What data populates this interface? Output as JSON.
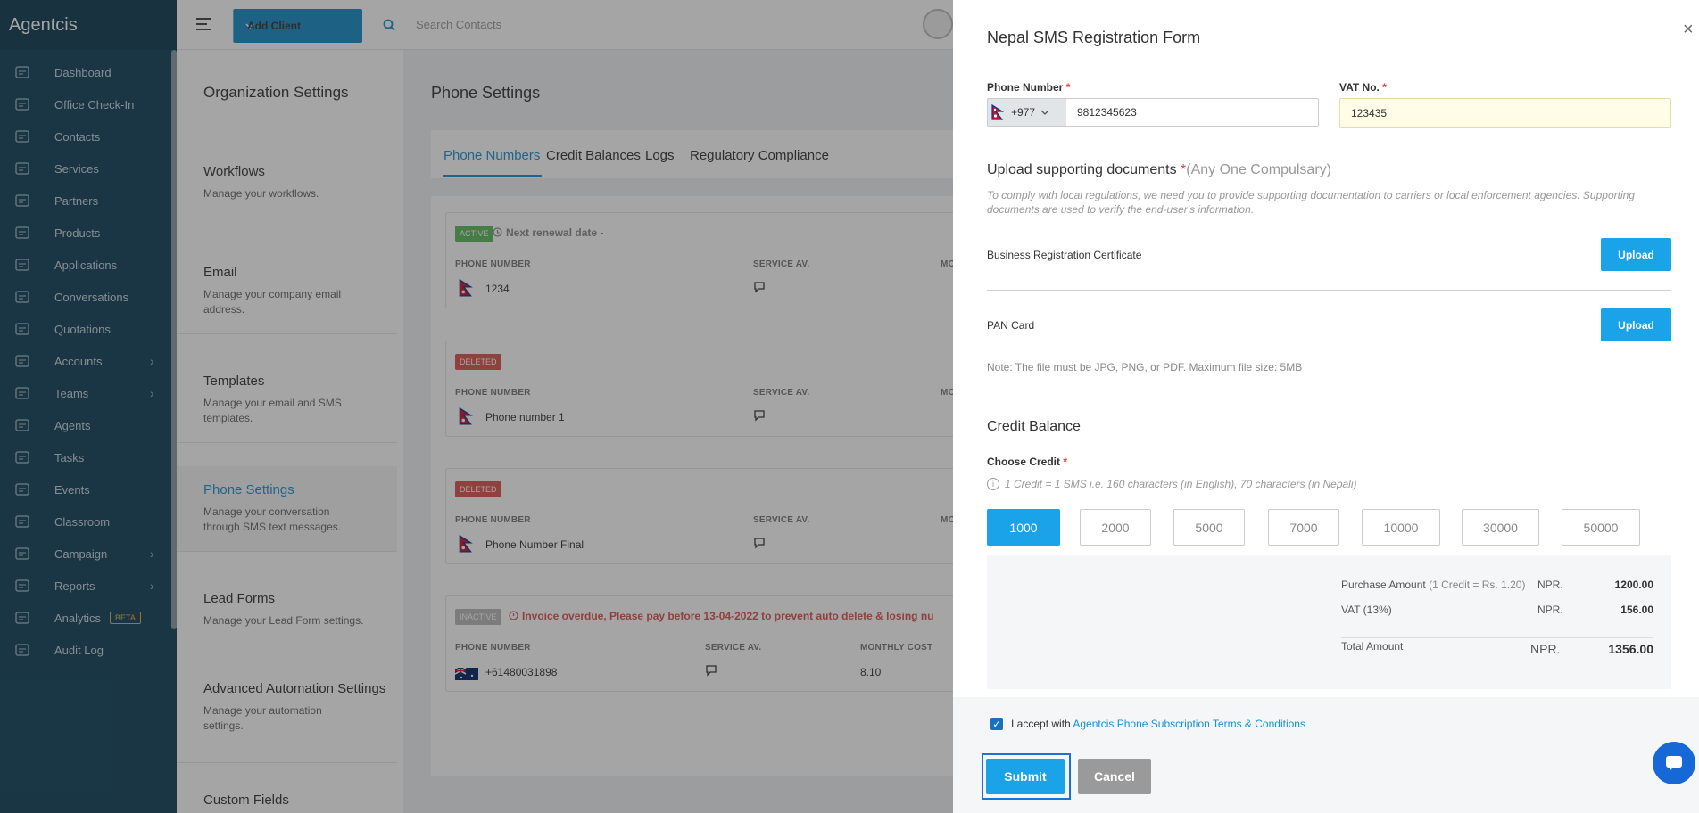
{
  "brand": "Agentcis",
  "sidebar": {
    "items": [
      {
        "label": "Dashboard",
        "icon": "gauge-icon",
        "chevron": false
      },
      {
        "label": "Office Check-In",
        "icon": "checkin-icon",
        "chevron": false
      },
      {
        "label": "Contacts",
        "icon": "contacts-icon",
        "chevron": false
      },
      {
        "label": "Services",
        "icon": "services-icon",
        "chevron": false
      },
      {
        "label": "Partners",
        "icon": "building-icon",
        "chevron": false
      },
      {
        "label": "Products",
        "icon": "grid-icon",
        "chevron": false
      },
      {
        "label": "Applications",
        "icon": "flow-icon",
        "chevron": false
      },
      {
        "label": "Conversations",
        "icon": "chat-icon",
        "chevron": false
      },
      {
        "label": "Quotations",
        "icon": "document-icon",
        "chevron": false
      },
      {
        "label": "Accounts",
        "icon": "dollar-icon",
        "chevron": true
      },
      {
        "label": "Teams",
        "icon": "team-icon",
        "chevron": true
      },
      {
        "label": "Agents",
        "icon": "agents-icon",
        "chevron": false
      },
      {
        "label": "Tasks",
        "icon": "briefcase-icon",
        "chevron": false
      },
      {
        "label": "Events",
        "icon": "calendar-icon",
        "chevron": false
      },
      {
        "label": "Classroom",
        "icon": "classroom-icon",
        "chevron": false
      },
      {
        "label": "Campaign",
        "icon": "megaphone-icon",
        "chevron": true
      },
      {
        "label": "Reports",
        "icon": "reports-icon",
        "chevron": true
      },
      {
        "label": "Analytics",
        "icon": "analytics-icon",
        "chevron": false,
        "badge": "BETA"
      },
      {
        "label": "Audit Log",
        "icon": "audit-icon",
        "chevron": false
      }
    ]
  },
  "topbar": {
    "add_client": "Add Client",
    "search_placeholder": "Search Contacts"
  },
  "settings": {
    "title": "Organization Settings",
    "items": [
      {
        "title": "Workflows",
        "desc": "Manage your workflows.",
        "active": false
      },
      {
        "title": "Email",
        "desc": "Manage your company email address.",
        "active": false
      },
      {
        "title": "Templates",
        "desc": "Manage your email and SMS templates.",
        "active": false
      },
      {
        "title": "Phone Settings",
        "desc": "Manage your conversation through SMS text messages.",
        "active": true
      },
      {
        "title": "Lead Forms",
        "desc": "Manage your Lead Form settings.",
        "active": false
      },
      {
        "title": "Advanced Automation Settings",
        "desc": "Manage your automation settings.",
        "active": false
      },
      {
        "title": "Custom Fields",
        "desc": "",
        "active": false
      }
    ]
  },
  "main": {
    "title": "Phone Settings",
    "tabs": [
      "Phone Numbers",
      "Credit Balances",
      "Logs",
      "Regulatory Compliance"
    ],
    "cards": [
      {
        "status": "ACTIVE",
        "note": "Next renewal date -",
        "headers": [
          "PHONE NUMBER",
          "SERVICE AV.",
          "MO"
        ],
        "number": "1234",
        "flag": "nepal"
      },
      {
        "status": "DELETED",
        "note": "",
        "headers": [
          "PHONE NUMBER",
          "SERVICE AV.",
          "MO"
        ],
        "number": "Phone number 1",
        "flag": "nepal"
      },
      {
        "status": "DELETED",
        "note": "",
        "headers": [
          "PHONE NUMBER",
          "SERVICE AV.",
          "MO"
        ],
        "number": "Phone Number Final",
        "flag": "nepal"
      },
      {
        "status": "INACTIVE",
        "note": "Invoice overdue, Please pay before 13-04-2022 to prevent auto delete & losing nu",
        "headers": [
          "PHONE NUMBER",
          "SERVICE AV.",
          "MONTHLY COST"
        ],
        "number": "+61480031898",
        "cost": "8.10",
        "flag": "australia"
      }
    ]
  },
  "drawer": {
    "title": "Nepal SMS Registration Form",
    "phone_label": "Phone Number",
    "country_code": "+977",
    "phone_value": "9812345623",
    "vat_label": "VAT No.",
    "vat_value": "123435",
    "upload_title": "Upload supporting documents",
    "upload_any": "(Any One Compulsary)",
    "upload_note": "To comply with local regulations, we need you to provide supporting documentation to carriers or local enforcement agencies. Supporting documents are used to verify the end-user's information.",
    "docs": [
      {
        "name": "Business Registration Certificate",
        "button": "Upload"
      },
      {
        "name": "PAN Card",
        "button": "Upload"
      }
    ],
    "file_note": "Note: The file must be JPG, PNG, or PDF. Maximum file size: 5MB",
    "credit_title": "Credit Balance",
    "choose_credit": "Choose Credit",
    "credit_info": "1 Credit = 1 SMS i.e. 160 characters (in English), 70 characters (in Nepali)",
    "credit_options": [
      "1000",
      "2000",
      "5000",
      "7000",
      "10000",
      "30000",
      "50000"
    ],
    "selected_credit": "1000",
    "summary": {
      "purchase_label": "Purchase Amount",
      "purchase_rate": "(1 Credit = Rs. 1.20)",
      "currency": "NPR.",
      "purchase_value": "1200.00",
      "vat_label": "VAT (13%)",
      "vat_value": "156.00",
      "total_label": "Total Amount",
      "total_value": "1356.00"
    },
    "terms_prefix": "I accept with",
    "terms_link": "Agentcis Phone Subscription Terms & Conditions",
    "submit": "Submit",
    "cancel": "Cancel",
    "accent": "#1aa3e8"
  }
}
